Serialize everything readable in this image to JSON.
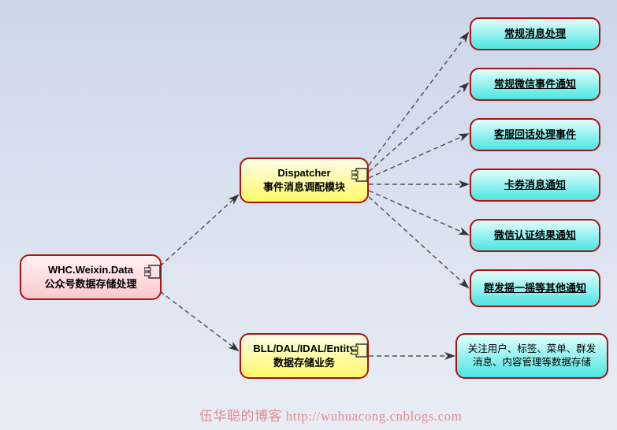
{
  "chart_data": {
    "type": "diagram",
    "title": "",
    "nodes": [
      {
        "id": "data",
        "label1": "WHC.Weixin.Data",
        "label2": "公众号数据存储处理",
        "style": "pink",
        "component_icon": true
      },
      {
        "id": "dispatcher",
        "label1": "Dispatcher",
        "label2": "事件消息调配模块",
        "style": "yellow",
        "component_icon": true
      },
      {
        "id": "bll",
        "label1": "BLL/DAL/IDAL/Entity",
        "label2": "数据存储业务",
        "style": "yellow",
        "component_icon": true
      },
      {
        "id": "r1",
        "label1": "常规消息处理",
        "style": "cyan",
        "underlined": true
      },
      {
        "id": "r2",
        "label1": "常规微信事件通知",
        "style": "cyan",
        "underlined": true
      },
      {
        "id": "r3",
        "label1": "客服回话处理事件",
        "style": "cyan",
        "underlined": true
      },
      {
        "id": "r4",
        "label1": "卡券消息通知",
        "style": "cyan",
        "underlined": true
      },
      {
        "id": "r5",
        "label1": "微信认证结果通知",
        "style": "cyan",
        "underlined": true
      },
      {
        "id": "r6",
        "label1": "群发摇一摇等其他通知",
        "style": "cyan",
        "underlined": true
      },
      {
        "id": "r7",
        "label1": "关注用户、标签、菜单、群发消息、内容管理等数据存储",
        "style": "cyan",
        "underlined": false
      }
    ],
    "edges": [
      {
        "from": "data",
        "to": "dispatcher",
        "style": "dashed"
      },
      {
        "from": "data",
        "to": "bll",
        "style": "dashed"
      },
      {
        "from": "dispatcher",
        "to": "r1",
        "style": "dashed"
      },
      {
        "from": "dispatcher",
        "to": "r2",
        "style": "dashed"
      },
      {
        "from": "dispatcher",
        "to": "r3",
        "style": "dashed"
      },
      {
        "from": "dispatcher",
        "to": "r4",
        "style": "dashed"
      },
      {
        "from": "dispatcher",
        "to": "r5",
        "style": "dashed"
      },
      {
        "from": "dispatcher",
        "to": "r6",
        "style": "dashed"
      },
      {
        "from": "bll",
        "to": "r7",
        "style": "dashed"
      }
    ]
  },
  "watermark": "伍华聪的博客 http://wuhuacong.cnblogs.com"
}
